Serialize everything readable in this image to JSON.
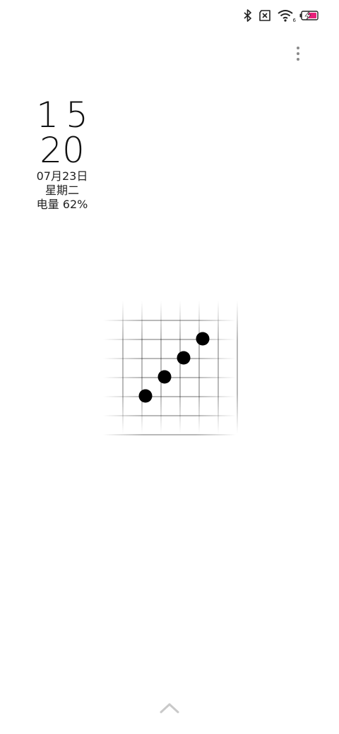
{
  "status_bar": {
    "icons": [
      "bluetooth-icon",
      "no-sim-icon",
      "wifi-icon",
      "battery-charging-icon"
    ],
    "wifi_badge": "6",
    "battery_color": "#e8207a"
  },
  "menu": {
    "icon": "more-vertical-icon"
  },
  "clock": {
    "hour": "15",
    "minute": "20",
    "date": "07月23日",
    "weekday": "星期二",
    "battery": "电量 62%"
  },
  "board": {
    "grid_lines": 7,
    "stones": [
      {
        "col": 2,
        "row": 5,
        "color": "black"
      },
      {
        "col": 3,
        "row": 4,
        "color": "black"
      },
      {
        "col": 4,
        "row": 3,
        "color": "black"
      },
      {
        "col": 5,
        "row": 2,
        "color": "black"
      }
    ]
  },
  "bottom": {
    "icon": "chevron-up-icon"
  }
}
